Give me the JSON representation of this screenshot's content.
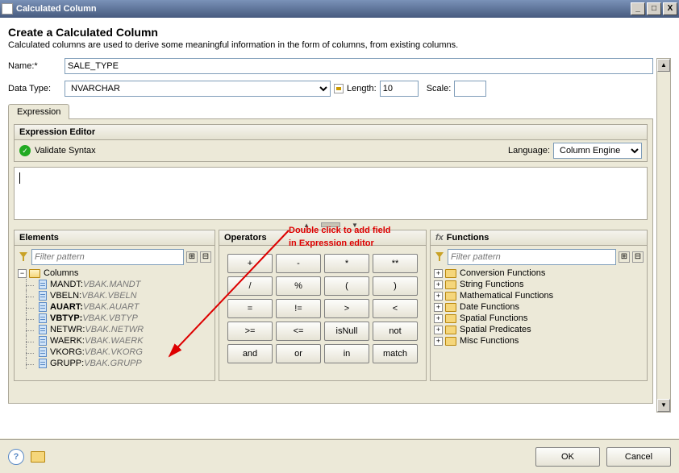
{
  "window": {
    "title": "Calculated Column",
    "min": "_",
    "max": "□",
    "close": "X"
  },
  "header": {
    "title": "Create a Calculated Column",
    "subtitle": "Calculated columns are used to derive some meaningful information in the form of columns, from existing columns."
  },
  "form": {
    "name_label": "Name:*",
    "name_value": "SALE_TYPE",
    "datatype_label": "Data Type:",
    "datatype_value": "NVARCHAR",
    "length_label": "Length:",
    "length_value": "10",
    "scale_label": "Scale:",
    "scale_value": ""
  },
  "tabs": {
    "expression": "Expression"
  },
  "editor": {
    "title": "Expression Editor",
    "validate": "Validate Syntax",
    "language_label": "Language:",
    "language_value": "Column Engine",
    "text": ""
  },
  "annotation": {
    "l1": "Double click to add field",
    "l2": "in Expression editor"
  },
  "elements": {
    "title": "Elements",
    "filter_ph": "Filter pattern",
    "root": "Columns",
    "items": [
      {
        "name": "MANDT",
        "tech": "VBAK.MANDT",
        "bold": false
      },
      {
        "name": "VBELN",
        "tech": "VBAK.VBELN",
        "bold": false
      },
      {
        "name": "AUART",
        "tech": "VBAK.AUART",
        "bold": true
      },
      {
        "name": "VBTYP",
        "tech": "VBAK.VBTYP",
        "bold": true
      },
      {
        "name": "NETWR",
        "tech": "VBAK.NETWR",
        "bold": false
      },
      {
        "name": "WAERK",
        "tech": "VBAK.WAERK",
        "bold": false
      },
      {
        "name": "VKORG",
        "tech": "VBAK.VKORG",
        "bold": false
      },
      {
        "name": "GRUPP",
        "tech": "VBAK.GRUPP",
        "bold": false
      }
    ]
  },
  "operators": {
    "title": "Operators",
    "buttons": [
      "+",
      "-",
      "*",
      "**",
      "/",
      "%",
      "(",
      ")",
      "=",
      "!=",
      ">",
      "<",
      ">=",
      "<=",
      "isNull",
      "not",
      "and",
      "or",
      "in",
      "match"
    ]
  },
  "functions": {
    "title": "Functions",
    "fx": "fx",
    "filter_ph": "Filter pattern",
    "cats": [
      "Conversion Functions",
      "String Functions",
      "Mathematical Functions",
      "Date Functions",
      "Spatial Functions",
      "Spatial Predicates",
      "Misc Functions"
    ]
  },
  "footer": {
    "ok": "OK",
    "cancel": "Cancel"
  },
  "scroll": {
    "up": "▲",
    "down": "▼"
  },
  "toolbtn": {
    "expand": "⊞",
    "collapse": "⊟"
  }
}
